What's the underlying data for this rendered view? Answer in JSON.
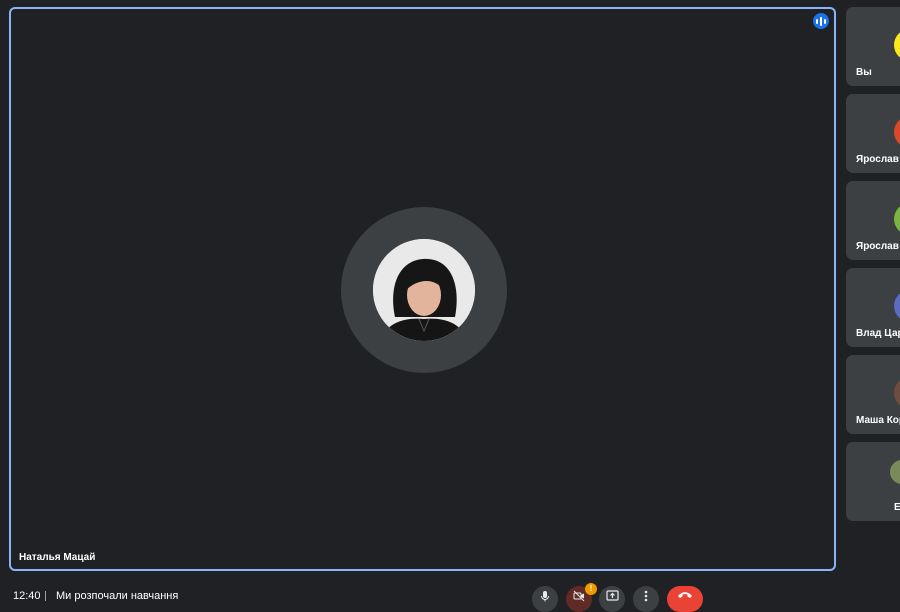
{
  "main_tile": {
    "participant_name": "Наталья Мацай",
    "speaking": true
  },
  "side_tiles": [
    {
      "name": "Вы",
      "avatar_color": "#f9e91e"
    },
    {
      "name": "Ярослав Б",
      "avatar_color": "#d9482b"
    },
    {
      "name": "Ярослав К",
      "avatar_color": "#7cb342"
    },
    {
      "name": "Влад Цар",
      "avatar_color": "#5c6bc0"
    },
    {
      "name": "Маша Кор",
      "avatar_color": "#6d4c41"
    },
    {
      "name": "Е",
      "avatar_color": "#7b8a5a"
    }
  ],
  "bottom_bar": {
    "time": "12:40",
    "meeting_title": "Ми розпочали навчання",
    "camera_alert_badge": "!"
  },
  "colors": {
    "background": "#202124",
    "tile": "#3c4043",
    "active_border": "#8ab4f8",
    "end_call": "#ea4335",
    "speaking": "#1a73e8"
  }
}
